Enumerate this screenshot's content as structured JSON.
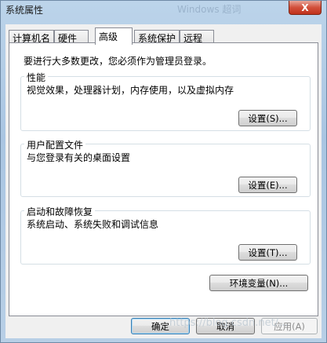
{
  "window": {
    "title": "系统属性",
    "background_title": "Windows 超词",
    "close_label": "X"
  },
  "tabs": [
    {
      "label": "计算机名"
    },
    {
      "label": "硬件"
    },
    {
      "label": "高级",
      "active": true
    },
    {
      "label": "系统保护"
    },
    {
      "label": "远程"
    }
  ],
  "panel": {
    "admin_note": "要进行大多数更改，您必须作为管理员登录。",
    "performance": {
      "title": "性能",
      "desc": "视觉效果，处理器计划，内存使用，以及虚拟内存",
      "button": "设置(S)..."
    },
    "user_profiles": {
      "title": "用户配置文件",
      "desc": "与您登录有关的桌面设置",
      "button": "设置(E)..."
    },
    "startup_recovery": {
      "title": "启动和故障恢复",
      "desc": "系统启动、系统失败和调试信息",
      "button": "设置(T)..."
    },
    "env_button": "环境变量(N)..."
  },
  "footer": {
    "ok": "确定",
    "cancel": "取消",
    "apply": "应用(A)"
  },
  "watermark": "https://blog.csdn.net/..."
}
